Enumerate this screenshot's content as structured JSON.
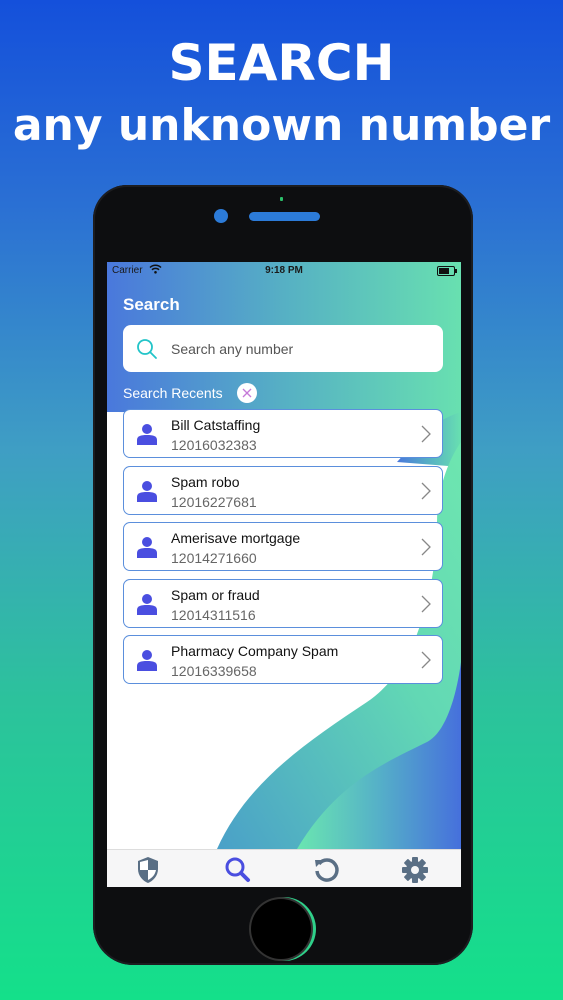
{
  "banner": {
    "line1": "SEARCH",
    "line2": "any unknown number"
  },
  "statusbar": {
    "carrier": "Carrier",
    "time": "9:18 PM"
  },
  "screen": {
    "title": "Search",
    "search": {
      "placeholder": "Search any number",
      "value": ""
    },
    "recents_label": "Search Recents",
    "recents": [
      {
        "name": "Bill Catstaffing",
        "number": "12016032383"
      },
      {
        "name": "Spam robo",
        "number": "12016227681"
      },
      {
        "name": "Amerisave mortgage",
        "number": "12014271660"
      },
      {
        "name": "Spam or fraud",
        "number": "12014311516"
      },
      {
        "name": "Pharmacy Company Spam",
        "number": "12016339658"
      }
    ]
  },
  "tabbar": {
    "tabs": [
      {
        "icon": "shield-icon",
        "active": false
      },
      {
        "icon": "search-icon",
        "active": true
      },
      {
        "icon": "history-icon",
        "active": false
      },
      {
        "icon": "gear-icon",
        "active": false
      }
    ]
  },
  "colors": {
    "accent": "#4a4ee0",
    "tab_inactive": "#5a6f85",
    "search_icon": "#22c4c8",
    "row_border": "#5b8fdc"
  }
}
